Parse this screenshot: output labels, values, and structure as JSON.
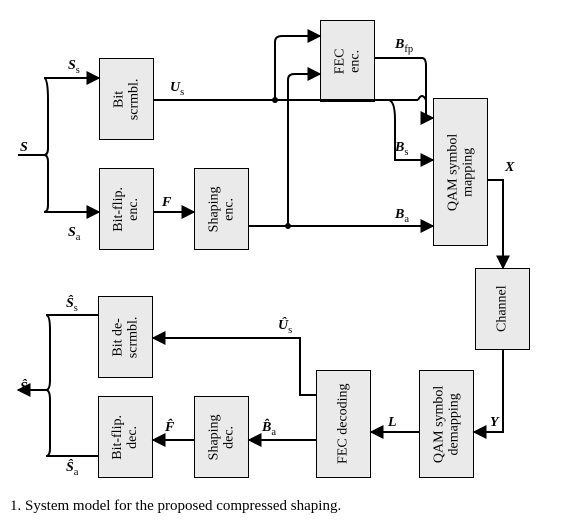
{
  "blocks": {
    "bit_scrmbl": "Bit\nscrmbl.",
    "bitflip_enc": "Bit-flip.\nenc.",
    "shaping_enc": "Shaping\nenc.",
    "fec_enc": "FEC\nenc.",
    "qam_map": "QAM symbol\nmapping",
    "channel": "Channel",
    "qam_demap": "QAM symbol\ndemapping",
    "fec_dec": "FEC decoding",
    "shaping_dec": "Shaping\ndec.",
    "bitflip_dec": "Bit-flip.\ndec.",
    "bit_descrmbl": "Bit de-\nscrmbl."
  },
  "labels": {
    "S": "S",
    "Ss": "S",
    "Ss_sub": "s",
    "Sa": "S",
    "Sa_sub": "a",
    "Us": "U",
    "Us_sub": "s",
    "F": "F",
    "Bfp": "B",
    "Bfp_sub": "fp",
    "Bs": "B",
    "Bs_sub": "s",
    "Ba": "B",
    "Ba_sub": "a",
    "X": "X",
    "Y": "Y",
    "L": "L",
    "Us_hat": "Û",
    "Us_hat_sub": "s",
    "Ba_hat": "B̂",
    "Ba_hat_sub": "a",
    "F_hat": "F̂",
    "Ss_hat": "Ŝ",
    "Ss_hat_sub": "s",
    "Sa_hat": "Ŝ",
    "Sa_hat_sub": "a",
    "S_hat": "Ŝ"
  },
  "caption": "1.   System model for the proposed compressed shaping."
}
